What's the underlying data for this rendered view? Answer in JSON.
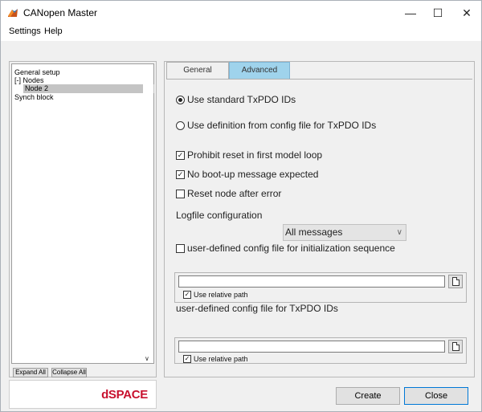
{
  "window": {
    "title": "CANopen Master",
    "controls": {
      "minimize": "—",
      "maximize": "☐",
      "close": "✕"
    }
  },
  "menubar": {
    "settings": "Settings",
    "help": "Help"
  },
  "tree": {
    "items": [
      {
        "label": "General setup",
        "selected": false
      },
      {
        "label": "[-] Nodes",
        "selected": false
      },
      {
        "label": "Node 2",
        "selected": true
      },
      {
        "label": "Synch block",
        "selected": false
      }
    ],
    "expand_all": "Expand All",
    "collapse_all": "Collapse All"
  },
  "logo": {
    "text": "dSPACE",
    "color": "#c8102e"
  },
  "tabs": [
    {
      "label": "General",
      "active": false
    },
    {
      "label": "Advanced",
      "active": true,
      "color": "#9fd3ec"
    }
  ],
  "advanced": {
    "radio_standard": {
      "label": "Use standard TxPDO IDs",
      "checked": true
    },
    "radio_config": {
      "label": "Use definition from config file for TxPDO IDs",
      "checked": false
    },
    "check_prohibit_reset": {
      "label": "Prohibit reset in first model loop",
      "checked": true
    },
    "check_no_bootup": {
      "label": "No boot-up message expected",
      "checked": true
    },
    "check_reset_node": {
      "label": "Reset node after error",
      "checked": false
    },
    "logfile_label": "Logfile configuration",
    "logfile_value": "All messages",
    "init_seq": {
      "label": "user-defined config file for initialization sequence",
      "checked": false,
      "path_value": "",
      "relative_label": "Use relative path",
      "relative_checked": true
    },
    "txpdo_file": {
      "label": "user-defined config file for TxPDO IDs",
      "path_value": "",
      "relative_label": "Use relative path",
      "relative_checked": true
    }
  },
  "buttons": {
    "create": "Create",
    "close": "Close"
  }
}
